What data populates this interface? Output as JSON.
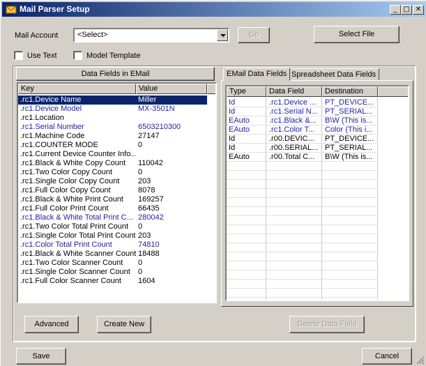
{
  "window": {
    "title": "Mail Parser Setup"
  },
  "top": {
    "mail_account_label": "Mail Account",
    "mail_account_value": "<Select>",
    "go_label": "Go",
    "select_file_label": "Select File",
    "use_text_label": "Use Text",
    "model_template_label": "Model Template"
  },
  "left_panel": {
    "title": "Data Fields in EMail",
    "columns": [
      "Key",
      "Value"
    ],
    "rows": [
      {
        "key": ".rc1.Device Name",
        "value": "Miller",
        "blue": true,
        "selected": true
      },
      {
        "key": ".rc1.Device Model",
        "value": "MX-3501N",
        "blue": true
      },
      {
        "key": ".rc1.Location",
        "value": ""
      },
      {
        "key": ".rc1.Serial Number",
        "value": "6503210300",
        "blue": true
      },
      {
        "key": ".rc1.Machine Code",
        "value": "27147"
      },
      {
        "key": ".rc1.COUNTER MODE",
        "value": "0"
      },
      {
        "key": ".rc1.Current Device Counter Info...",
        "value": ""
      },
      {
        "key": ".rc1.Black & White Copy Count",
        "value": "110042"
      },
      {
        "key": ".rc1.Two Color Copy Count",
        "value": "0"
      },
      {
        "key": ".rc1.Single Color Copy Count",
        "value": "203"
      },
      {
        "key": ".rc1.Full Color Copy Count",
        "value": "8078"
      },
      {
        "key": ".rc1.Black & White Print Count",
        "value": "169257"
      },
      {
        "key": ".rc1.Full Color Print Count",
        "value": "66435"
      },
      {
        "key": ".rc1.Black & White Total Print C...",
        "value": "280042",
        "blue": true
      },
      {
        "key": ".rc1.Two Color Total Print Count",
        "value": "0"
      },
      {
        "key": ".rc1.Single Color Total Print Count",
        "value": "203"
      },
      {
        "key": ".rc1.Color Total Print Count",
        "value": "74810",
        "blue": true
      },
      {
        "key": ".rc1.Black & White Scanner Count",
        "value": "18488"
      },
      {
        "key": ".rc1.Two Color Scanner Count",
        "value": "0"
      },
      {
        "key": ".rc1.Single Color Scanner Count",
        "value": "0"
      },
      {
        "key": ".rc1.Full Color Scanner Count",
        "value": "1604"
      }
    ]
  },
  "right_panel": {
    "tabs": [
      "EMail Data Fields",
      "Spreadsheet Data Fields"
    ],
    "columns": [
      "Type",
      "Data Field",
      "Destination"
    ],
    "rows": [
      {
        "type": "Id",
        "field": ".rc1.Device ...",
        "dest": "PT_DEVICE...",
        "blue": true
      },
      {
        "type": "Id",
        "field": ".rc1.Serial N...",
        "dest": "PT_SERIAL...",
        "blue": true
      },
      {
        "type": "EAuto",
        "field": ".rc1.Black &...",
        "dest": "B\\W (This is...",
        "blue": true
      },
      {
        "type": "EAuto",
        "field": ".rc1.Color T...",
        "dest": "Color (This i...",
        "blue": true
      },
      {
        "type": "Id",
        "field": ".r00.DEVIC...",
        "dest": "PT_DEVICE..."
      },
      {
        "type": "Id",
        "field": ".r00.SERIAL...",
        "dest": "PT_SERIAL..."
      },
      {
        "type": "EAuto",
        "field": ".r00.Total C...",
        "dest": "B\\W (This is..."
      }
    ],
    "delete_label": "Delete Data Field"
  },
  "bottom": {
    "advanced_label": "Advanced",
    "create_new_label": "Create New",
    "save_label": "Save",
    "cancel_label": "Cancel"
  },
  "colors": {
    "title_start": "#0a246a",
    "title_end": "#a6caf0",
    "link_blue": "#1f1fa0",
    "selection": "#0a246a",
    "desktop": "#f4a000"
  },
  "icons": {
    "title": "envelope-icon",
    "minimize": "minimize-icon",
    "maximize": "maximize-icon",
    "close": "close-icon"
  }
}
